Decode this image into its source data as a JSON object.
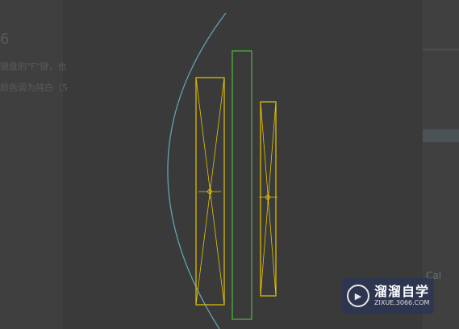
{
  "left_panel": {
    "heading": "6",
    "line1": "键盘的\"F\"键，也",
    "line2": "颜色调为纯白（5"
  },
  "watermark": {
    "title": "溜溜自学",
    "url": "ZIXUE.3066.COM"
  },
  "right_panel": {
    "faint_text": "Cal"
  },
  "colors": {
    "background": "#3a3a3a",
    "arc": "#5fa3b0",
    "yellow": "#e6c400",
    "green": "#4caf3a"
  }
}
